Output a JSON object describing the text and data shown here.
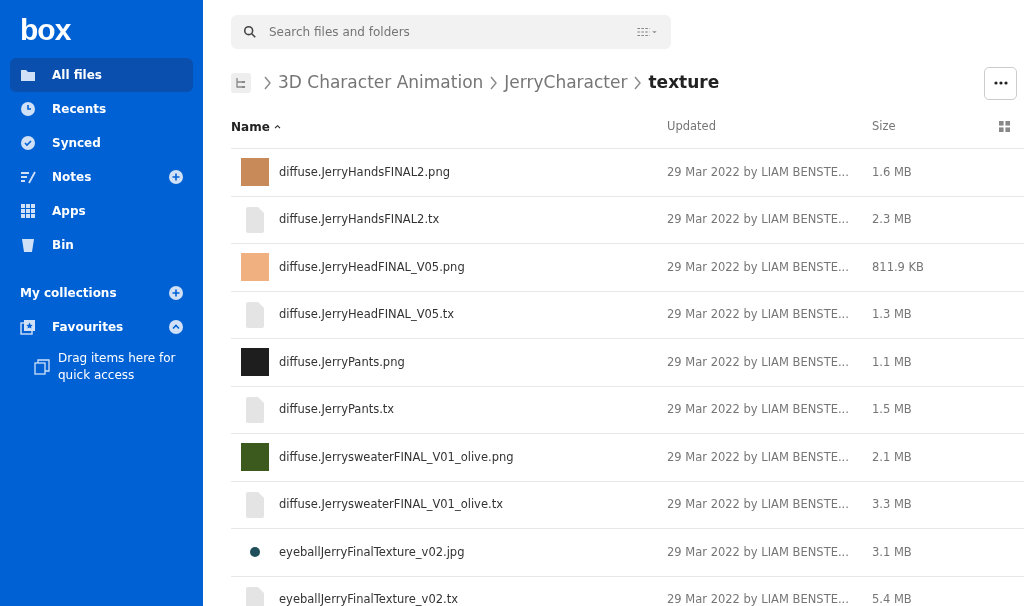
{
  "logo": "box",
  "sidebar": {
    "items": [
      {
        "label": "All files",
        "kind": "folder",
        "selected": true,
        "add": false
      },
      {
        "label": "Recents",
        "kind": "clock",
        "selected": false,
        "add": false
      },
      {
        "label": "Synced",
        "kind": "check",
        "selected": false,
        "add": false
      },
      {
        "label": "Notes",
        "kind": "notes",
        "selected": false,
        "add": true
      },
      {
        "label": "Apps",
        "kind": "apps",
        "selected": false,
        "add": false
      },
      {
        "label": "Bin",
        "kind": "bin",
        "selected": false,
        "add": false
      }
    ],
    "collections": {
      "title": "My collections",
      "favourites": {
        "label": "Favourites",
        "expanded": true
      },
      "hint": "Drag items here for quick access"
    }
  },
  "search": {
    "placeholder": "Search files and folders"
  },
  "breadcrumb": [
    "3D Character Animation",
    "JerryCharacter",
    "texture"
  ],
  "table": {
    "columns": [
      "Name",
      "Updated",
      "Size"
    ],
    "rows": [
      {
        "name": "diffuse.JerryHandsFINAL2.png",
        "updated": "29 Mar 2022 by LIAM BENSTE...",
        "size": "1.6 MB",
        "kind": "image",
        "color": "#c98a5a"
      },
      {
        "name": "diffuse.JerryHandsFINAL2.tx",
        "updated": "29 Mar 2022 by LIAM BENSTE...",
        "size": "2.3 MB",
        "kind": "file"
      },
      {
        "name": "diffuse.JerryHeadFINAL_V05.png",
        "updated": "29 Mar 2022 by LIAM BENSTE...",
        "size": "811.9 KB",
        "kind": "image",
        "color": "#f0b080"
      },
      {
        "name": "diffuse.JerryHeadFINAL_V05.tx",
        "updated": "29 Mar 2022 by LIAM BENSTE...",
        "size": "1.3 MB",
        "kind": "file"
      },
      {
        "name": "diffuse.JerryPants.png",
        "updated": "29 Mar 2022 by LIAM BENSTE...",
        "size": "1.1 MB",
        "kind": "image",
        "color": "#1e1e1e"
      },
      {
        "name": "diffuse.JerryPants.tx",
        "updated": "29 Mar 2022 by LIAM BENSTE...",
        "size": "1.5 MB",
        "kind": "file"
      },
      {
        "name": "diffuse.JerrysweaterFINAL_V01_olive.png",
        "updated": "29 Mar 2022 by LIAM BENSTE...",
        "size": "2.1 MB",
        "kind": "image",
        "color": "#3d5a1e"
      },
      {
        "name": "diffuse.JerrysweaterFINAL_V01_olive.tx",
        "updated": "29 Mar 2022 by LIAM BENSTE...",
        "size": "3.3 MB",
        "kind": "file"
      },
      {
        "name": "eyeballJerryFinalTexture_v02.jpg",
        "updated": "29 Mar 2022 by LIAM BENSTE...",
        "size": "3.1 MB",
        "kind": "round-image",
        "color": "#1f4f5a"
      },
      {
        "name": "eyeballJerryFinalTexture_v02.tx",
        "updated": "29 Mar 2022 by LIAM BENSTE...",
        "size": "5.4 MB",
        "kind": "file"
      }
    ]
  }
}
